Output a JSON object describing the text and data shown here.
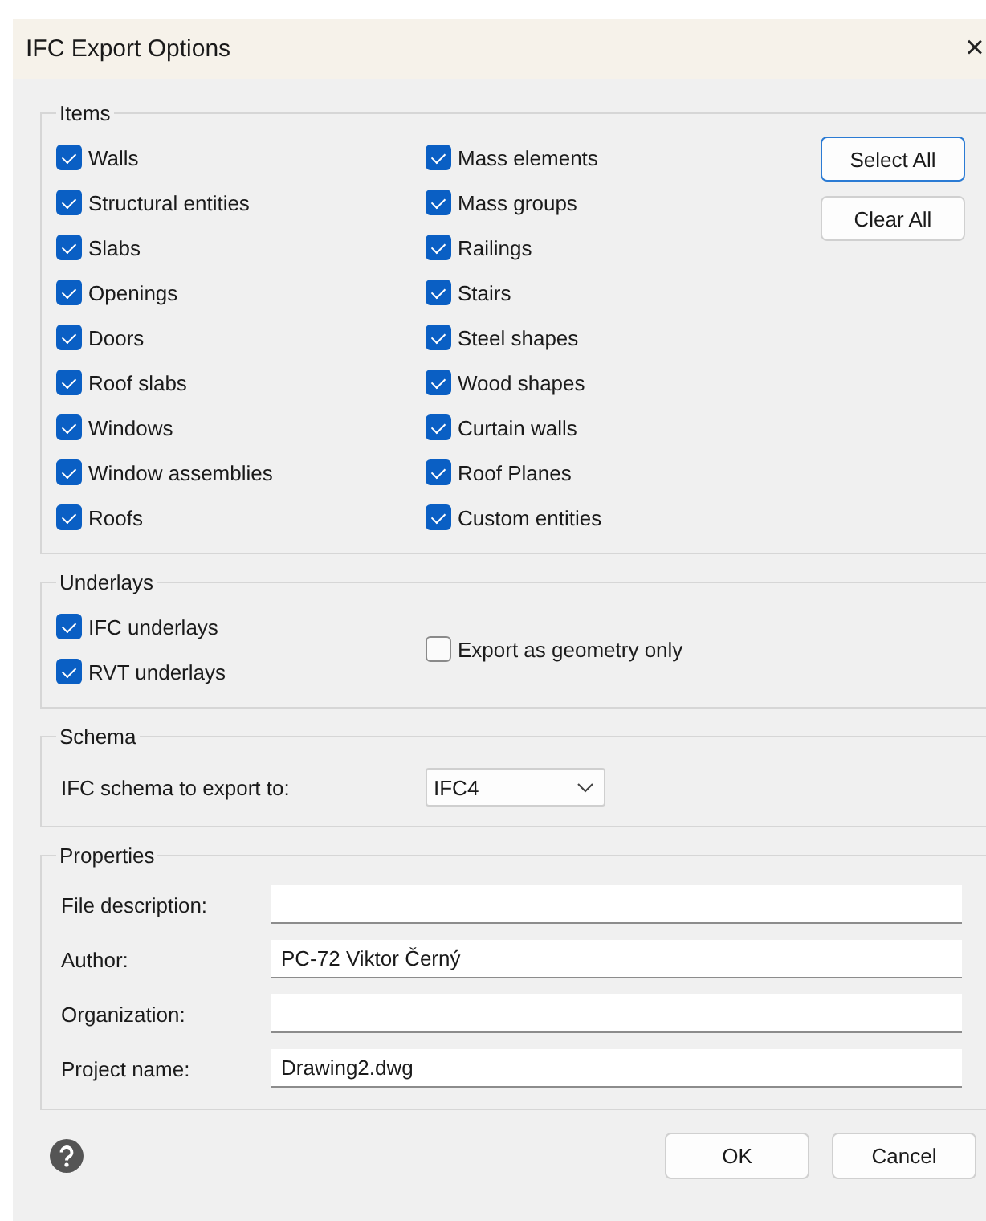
{
  "window": {
    "title": "IFC Export Options",
    "close": "×"
  },
  "items": {
    "legend": "Items",
    "columns": [
      [
        {
          "label": "Walls",
          "checked": true
        },
        {
          "label": "Structural entities",
          "checked": true
        },
        {
          "label": "Slabs",
          "checked": true
        },
        {
          "label": "Openings",
          "checked": true
        },
        {
          "label": "Doors",
          "checked": true
        },
        {
          "label": "Roof slabs",
          "checked": true
        },
        {
          "label": "Windows",
          "checked": true
        },
        {
          "label": "Window assemblies",
          "checked": true
        },
        {
          "label": "Roofs",
          "checked": true
        }
      ],
      [
        {
          "label": "Mass elements",
          "checked": true
        },
        {
          "label": "Mass groups",
          "checked": true
        },
        {
          "label": "Railings",
          "checked": true
        },
        {
          "label": "Stairs",
          "checked": true
        },
        {
          "label": "Steel shapes",
          "checked": true
        },
        {
          "label": "Wood shapes",
          "checked": true
        },
        {
          "label": "Curtain walls",
          "checked": true
        },
        {
          "label": "Roof Planes",
          "checked": true
        },
        {
          "label": "Custom entities",
          "checked": true
        }
      ]
    ],
    "buttons": [
      {
        "label": "Select All",
        "focused": true
      },
      {
        "label": "Clear All",
        "focused": false
      }
    ]
  },
  "underlays": {
    "legend": "Underlays",
    "options": [
      {
        "label": "IFC underlays",
        "checked": true
      },
      {
        "label": "RVT underlays",
        "checked": true
      }
    ],
    "geometry_only": {
      "label": "Export as geometry only",
      "checked": false
    }
  },
  "schema": {
    "legend": "Schema",
    "label": "IFC schema to export to:",
    "value": "IFC4"
  },
  "properties": {
    "legend": "Properties",
    "fields": [
      {
        "label": "File description:"
      },
      {
        "label": "Author:",
        "value": "PC-72 Viktor Černý"
      },
      {
        "label": "Organization:"
      },
      {
        "label": "Project name:",
        "value": "Drawing2.dwg"
      }
    ]
  },
  "footer": {
    "buttons": [
      "OK",
      "Cancel"
    ]
  }
}
